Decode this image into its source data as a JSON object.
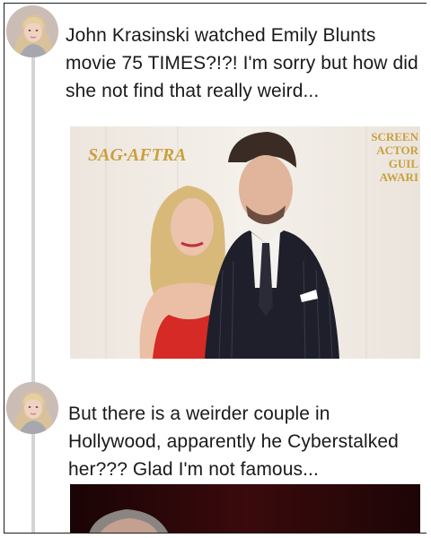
{
  "posts": [
    {
      "avatar_icon": "profile-photo-avatar",
      "text": "John Krasinski watched Emily Blunts movie 75 TIMES?!?! I'm sorry but how did she not find that really weird...",
      "image": {
        "backdrop_left_text": "SAG·AFTRA",
        "backdrop_right_lines": [
          "SCREEN",
          "ACTOR",
          "GUIL",
          "AWARI"
        ],
        "backdrop_color": "#f1ece6",
        "logo_color": "#c9a03c"
      }
    },
    {
      "avatar_icon": "profile-photo-avatar",
      "text": "But there is a weirder couple in Hollywood, apparently he Cyberstalked her??? Glad I'm not famous...",
      "image": {
        "backdrop_color": "#2a0608"
      }
    }
  ]
}
